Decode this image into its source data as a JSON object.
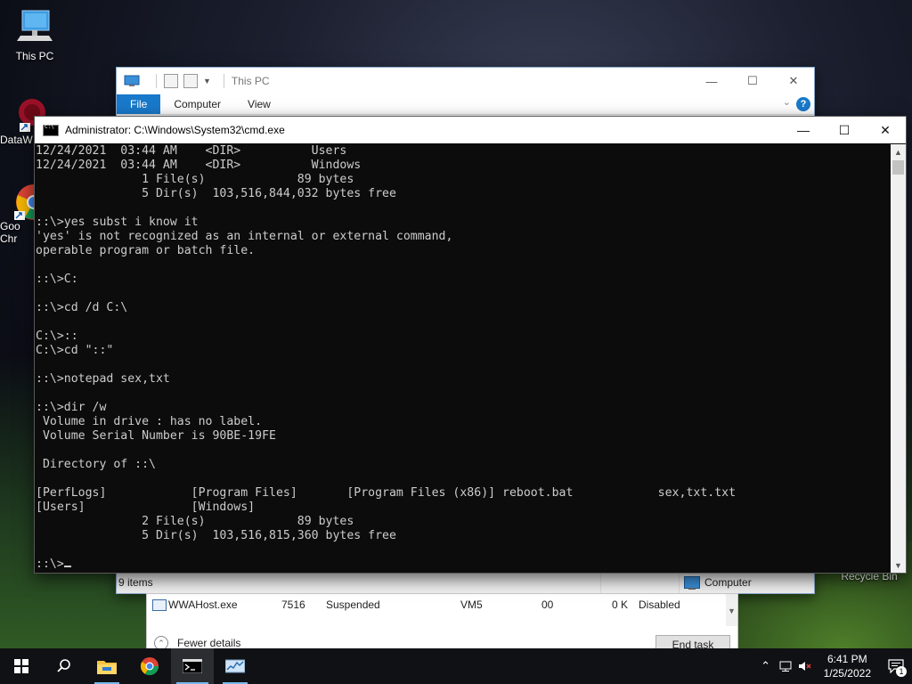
{
  "desktop": {
    "icons": [
      {
        "label": "This PC"
      },
      {
        "label": "DataW"
      },
      {
        "label": "Goo Chr"
      },
      {
        "label": "Recycle Bin"
      }
    ]
  },
  "explorer": {
    "title": "This PC",
    "tabs": [
      "File",
      "Computer",
      "View"
    ],
    "help": "?",
    "status_items": "9 items",
    "status_location": "Computer"
  },
  "taskmgr": {
    "row": {
      "name": "WWAHost.exe",
      "pid": "7516",
      "status": "Suspended",
      "user": "VM5",
      "cpu": "00",
      "memory": "0 K",
      "uac": "Disabled"
    },
    "fewer_details": "Fewer details",
    "end_task": "End task"
  },
  "cmd": {
    "title": "Administrator: C:\\Windows\\System32\\cmd.exe",
    "lines": [
      "12/24/2021  03:44 AM    <DIR>          Users",
      "12/24/2021  03:44 AM    <DIR>          Windows",
      "               1 File(s)             89 bytes",
      "               5 Dir(s)  103,516,844,032 bytes free",
      "",
      "::\\>yes subst i know it",
      "'yes' is not recognized as an internal or external command,",
      "operable program or batch file.",
      "",
      "::\\>C:",
      "",
      "::\\>cd /d C:\\",
      "",
      "C:\\>::",
      "C:\\>cd \"::\"",
      "",
      "::\\>notepad sex,txt",
      "",
      "::\\>dir /w",
      " Volume in drive : has no label.",
      " Volume Serial Number is 90BE-19FE",
      "",
      " Directory of ::\\",
      "",
      "[PerfLogs]            [Program Files]       [Program Files (x86)] reboot.bat            sex,txt.txt",
      "[Users]               [Windows]",
      "               2 File(s)             89 bytes",
      "               5 Dir(s)  103,516,815,360 bytes free",
      ""
    ],
    "prompt": "::\\>"
  },
  "taskbar": {
    "apps": [
      {
        "icon": "file-explorer-icon"
      },
      {
        "icon": "chrome-icon"
      },
      {
        "icon": "cmd-icon"
      },
      {
        "icon": "task-manager-icon"
      }
    ],
    "time": "6:41 PM",
    "date": "1/25/2022",
    "notification_count": "1"
  },
  "colors": {
    "accent": "#1979ca",
    "console_bg": "#0c0c0c",
    "console_fg": "#cccccc",
    "taskbar_bg": "#101114"
  }
}
